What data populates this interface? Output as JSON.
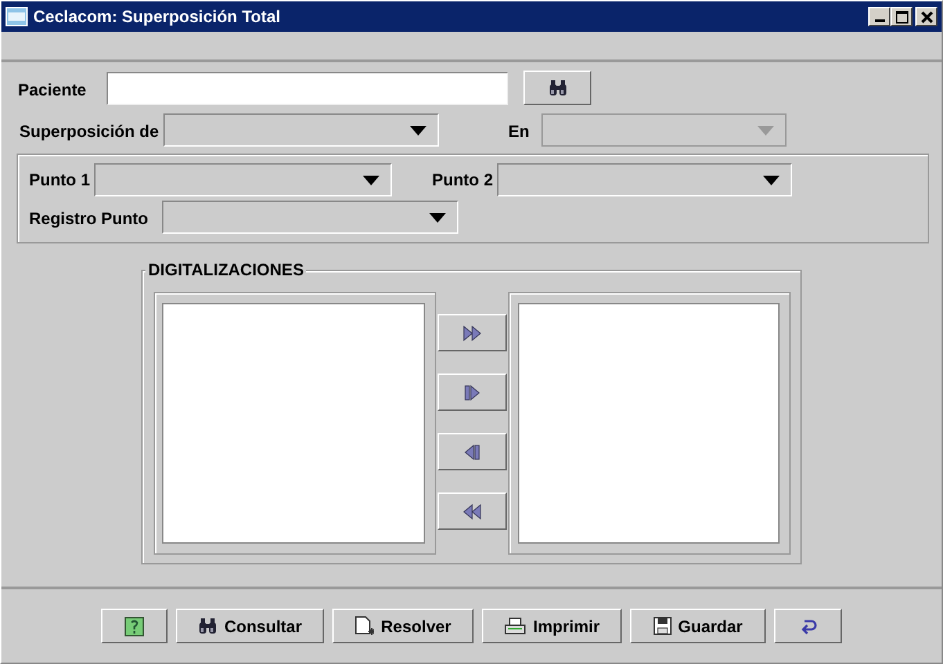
{
  "window": {
    "title": "Ceclacom: Superposición Total"
  },
  "patient": {
    "label": "Paciente"
  },
  "overlay": {
    "label": "Superposición de",
    "disabled": false
  },
  "target": {
    "label": "En",
    "disabled": true
  },
  "points": [
    {
      "label": "Punto 1",
      "disabled": false
    },
    {
      "label": "Punto 2",
      "disabled": false
    },
    {
      "label": "Registro Punto",
      "disabled": false
    }
  ],
  "scans": {
    "title": "DIGITALIZACIONES"
  },
  "transfer_buttons": [
    {
      "kind": "all-right"
    },
    {
      "kind": "right"
    },
    {
      "kind": "left"
    },
    {
      "kind": "all-left"
    }
  ],
  "buttons": [
    {
      "kind": "help"
    },
    {
      "kind": "search",
      "label": "Consultar"
    },
    {
      "kind": "resolve",
      "label": "Resolver"
    },
    {
      "kind": "print",
      "label": "Imprimir"
    },
    {
      "kind": "save",
      "label": "Guardar"
    },
    {
      "kind": "back"
    }
  ]
}
